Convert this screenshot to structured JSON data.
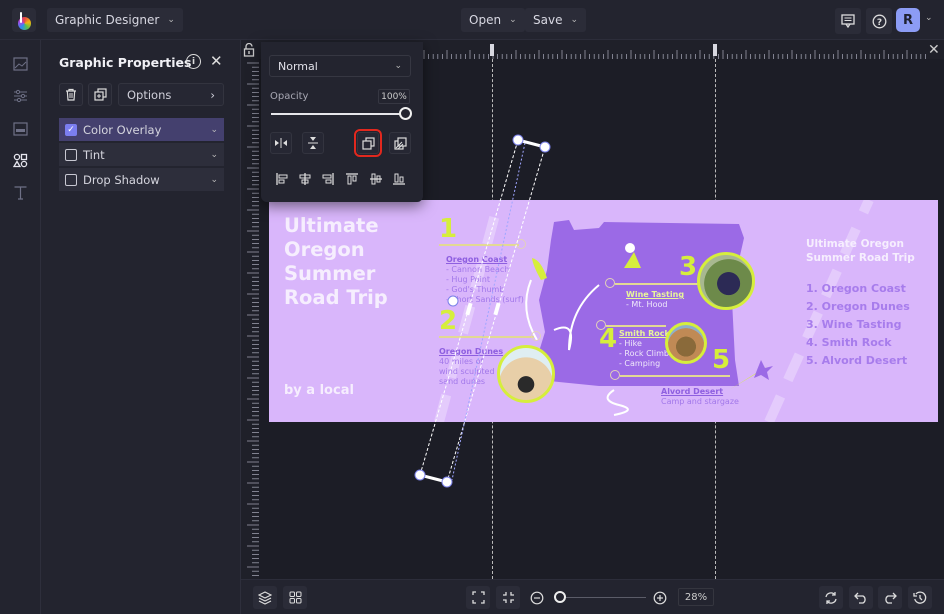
{
  "topbar": {
    "app_mode": "Graphic Designer",
    "open_label": "Open",
    "save_label": "Save",
    "avatar_initial": "R",
    "icons": [
      "logo-icon",
      "chevron-down-icon",
      "comment-icon",
      "help-icon"
    ]
  },
  "rail": {
    "items": [
      {
        "name": "image-icon",
        "active": false
      },
      {
        "name": "adjustments-icon",
        "active": false
      },
      {
        "name": "layout-icon",
        "active": false
      },
      {
        "name": "shapes-icon",
        "active": true
      },
      {
        "name": "text-icon",
        "active": false
      }
    ]
  },
  "panel": {
    "title": "Graphic Properties",
    "info_glyph": "i",
    "close_glyph": "✕",
    "options_label": "Options",
    "effects": [
      {
        "label": "Color Overlay",
        "checked": true
      },
      {
        "label": "Tint",
        "checked": false
      },
      {
        "label": "Drop Shadow",
        "checked": false
      }
    ]
  },
  "popup": {
    "blend_mode": "Normal",
    "opacity_label": "Opacity",
    "opacity_value": "100%",
    "opacity_fraction": 1.0,
    "buttons": [
      "flip-horizontal",
      "flip-vertical",
      "bring-forward",
      "send-backward"
    ],
    "highlighted_button": "bring-forward",
    "align_buttons": [
      "align-left",
      "align-center-horizontal",
      "align-right",
      "align-top",
      "align-middle",
      "align-bottom"
    ]
  },
  "design": {
    "title": "Ultimate Oregon Summer Road Trip",
    "byline": "by a local",
    "colors": {
      "background": "#d9b6fb",
      "map": "#9b6ae6",
      "accent": "#d6ee3c"
    },
    "stops": [
      {
        "num": "1",
        "heading": "Oregon Coast",
        "items": [
          "- Cannon Beach",
          "- Hug Point",
          "- God's Thumb",
          "- Short Sands (surf)"
        ]
      },
      {
        "num": "2",
        "heading": "Oregon Dunes",
        "items": [
          "40 miles of",
          "wind sculpted",
          "sand dunes"
        ]
      },
      {
        "num": "3",
        "heading": "Wine Tasting",
        "items": [
          "- Mt. Hood"
        ]
      },
      {
        "num": "4",
        "heading": "Smith Rock",
        "items": [
          "- Hike",
          "- Rock Climb",
          "- Camping"
        ]
      },
      {
        "num": "5",
        "heading": "Alvord Desert",
        "items": [
          "Camp and stargaze"
        ]
      }
    ],
    "sidebar_title": "Ultimate Oregon Summer Road Trip",
    "sidebar_list": [
      "1. Oregon Coast",
      "2. Oregon Dunes",
      "3. Wine Tasting",
      "4. Smith Rock",
      "5. Alvord Desert"
    ]
  },
  "bottombar": {
    "zoom_value": "28%",
    "zoom_fraction": 0.05,
    "icons": [
      "layers-icon",
      "grid-icon",
      "fit-screen-icon",
      "shrink-icon",
      "zoom-out-icon",
      "zoom-in-icon",
      "replace-icon",
      "undo-icon",
      "redo-icon",
      "history-icon"
    ]
  }
}
